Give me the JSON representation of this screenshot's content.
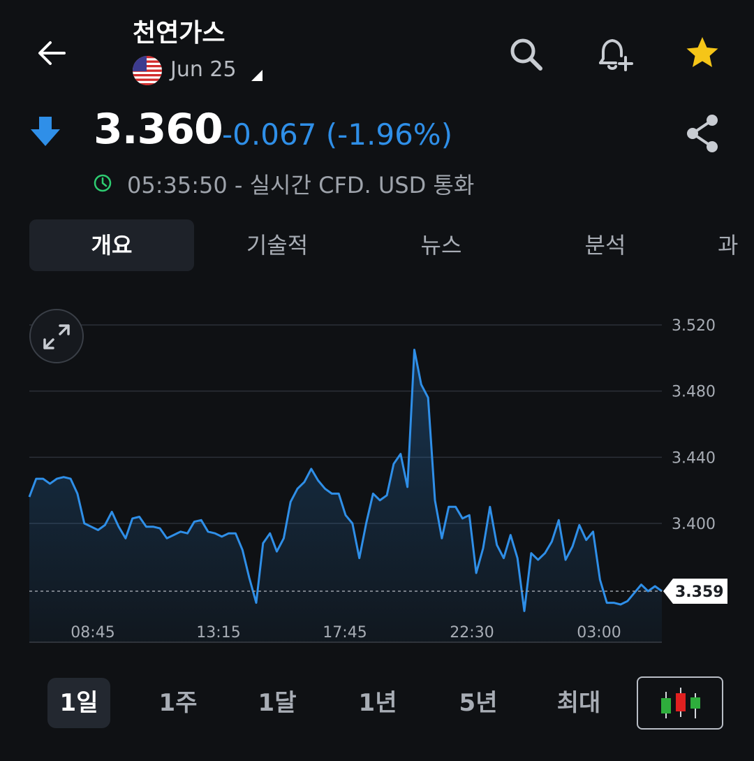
{
  "header": {
    "title": "천연가스",
    "expiry": "Jun 25",
    "icons": {
      "back": "back-arrow-icon",
      "search": "search-icon",
      "alert": "bell-plus-icon",
      "watchlist": "star-icon"
    }
  },
  "quote": {
    "price": "3.360",
    "change": "-0.067 (-1.96%)",
    "meta": "05:35:50 - 실시간 CFD. USD 통화",
    "colors": {
      "down": "#2f8fe8",
      "clock": "#2ecc71",
      "star": "#f5c518"
    }
  },
  "tabs": [
    {
      "label": "개요",
      "active": true
    },
    {
      "label": "기술적",
      "active": false
    },
    {
      "label": "뉴스",
      "active": false
    },
    {
      "label": "분석",
      "active": false
    },
    {
      "label": "과거",
      "active": false
    }
  ],
  "ranges": [
    {
      "label": "1일",
      "active": true
    },
    {
      "label": "1주",
      "active": false
    },
    {
      "label": "1달",
      "active": false
    },
    {
      "label": "1년",
      "active": false
    },
    {
      "label": "5년",
      "active": false
    },
    {
      "label": "최대",
      "active": false
    }
  ],
  "chart_data": {
    "type": "area",
    "y_ticks": [
      "3.520",
      "3.480",
      "3.440",
      "3.400"
    ],
    "x_ticks": [
      "08:45",
      "13:15",
      "17:45",
      "22:30",
      "03:00"
    ],
    "last_value": "3.359",
    "ylim": [
      3.36,
      3.52
    ],
    "line_color": "#2f8fe8",
    "values": [
      3.416,
      3.427,
      3.427,
      3.424,
      3.427,
      3.428,
      3.427,
      3.418,
      3.4,
      3.398,
      3.396,
      3.399,
      3.407,
      3.398,
      3.391,
      3.403,
      3.404,
      3.398,
      3.398,
      3.397,
      3.391,
      3.393,
      3.395,
      3.394,
      3.401,
      3.402,
      3.395,
      3.394,
      3.392,
      3.394,
      3.394,
      3.384,
      3.367,
      3.352,
      3.388,
      3.394,
      3.383,
      3.391,
      3.413,
      3.421,
      3.425,
      3.433,
      3.426,
      3.421,
      3.418,
      3.418,
      3.405,
      3.4,
      3.379,
      3.4,
      3.418,
      3.414,
      3.417,
      3.436,
      3.442,
      3.422,
      3.505,
      3.484,
      3.476,
      3.414,
      3.391,
      3.41,
      3.41,
      3.403,
      3.405,
      3.37,
      3.385,
      3.41,
      3.387,
      3.379,
      3.393,
      3.379,
      3.347,
      3.382,
      3.378,
      3.382,
      3.389,
      3.402,
      3.378,
      3.386,
      3.399,
      3.39,
      3.395,
      3.366,
      3.352,
      3.352,
      3.351,
      3.353,
      3.358,
      3.363,
      3.359,
      3.362,
      3.359
    ]
  }
}
